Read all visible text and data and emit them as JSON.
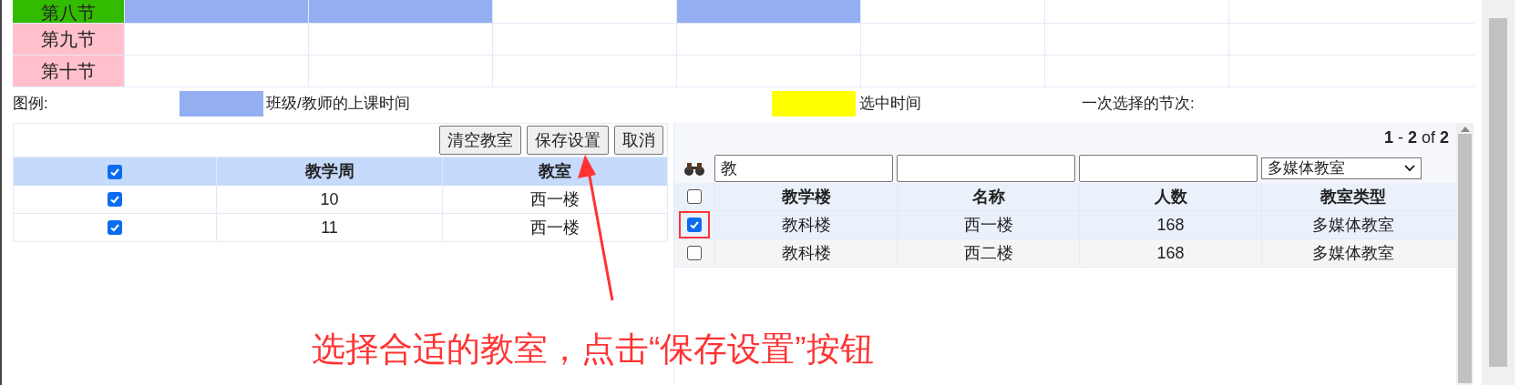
{
  "schedule": {
    "rows": [
      {
        "label": "第八节",
        "color": "#33bb00",
        "cells": [
          {
            "occupied": true
          },
          {
            "occupied": true
          },
          {
            "occupied": false
          },
          {
            "occupied": true
          },
          {
            "occupied": false
          },
          {
            "occupied": false
          },
          {
            "occupied": false
          }
        ]
      },
      {
        "label": "第九节",
        "color": "#ffc0cb",
        "cells": [
          {
            "occupied": false
          },
          {
            "occupied": false
          },
          {
            "occupied": false
          },
          {
            "occupied": false
          },
          {
            "occupied": false
          },
          {
            "occupied": false
          },
          {
            "occupied": false
          }
        ]
      },
      {
        "label": "第十节",
        "color": "#ffc0cb",
        "cells": [
          {
            "occupied": false
          },
          {
            "occupied": false
          },
          {
            "occupied": false
          },
          {
            "occupied": false
          },
          {
            "occupied": false
          },
          {
            "occupied": false
          },
          {
            "occupied": false
          }
        ]
      }
    ]
  },
  "legend": {
    "label": "图例:",
    "items": [
      {
        "color": "#94aef2",
        "text": "班级/教师的上课时间"
      },
      {
        "color": "#ffff00",
        "text": "选中时间"
      }
    ],
    "periods_label": "一次选择的节次:"
  },
  "left_panel": {
    "buttons": [
      "清空教室",
      "保存设置",
      "取消"
    ],
    "header": {
      "checked": true,
      "columns": [
        "教学周",
        "教室"
      ]
    },
    "rows": [
      {
        "checked": true,
        "cells": [
          "10",
          "西一楼"
        ]
      },
      {
        "checked": true,
        "cells": [
          "11",
          "西一楼"
        ]
      }
    ]
  },
  "right_panel": {
    "pager": "**1** - **2** of **2**",
    "filters": [
      {
        "kind": "text",
        "value": "教"
      },
      {
        "kind": "text"
      },
      {
        "kind": "text"
      },
      {
        "kind": "select",
        "value": "多媒体教室"
      }
    ],
    "header": {
      "checked": false,
      "columns": [
        "教学楼",
        "名称",
        "人数",
        "教室类型"
      ]
    },
    "rows": [
      {
        "checked": true,
        "cells": [
          "教科楼",
          "西一楼",
          "168",
          "多媒体教室"
        ]
      },
      {
        "checked": false,
        "cells": [
          "教科楼",
          "西二楼",
          "168",
          "多媒体教室"
        ]
      }
    ]
  },
  "annotation": {
    "text": "选择合适的教室，点击“保存设置”按钮"
  }
}
